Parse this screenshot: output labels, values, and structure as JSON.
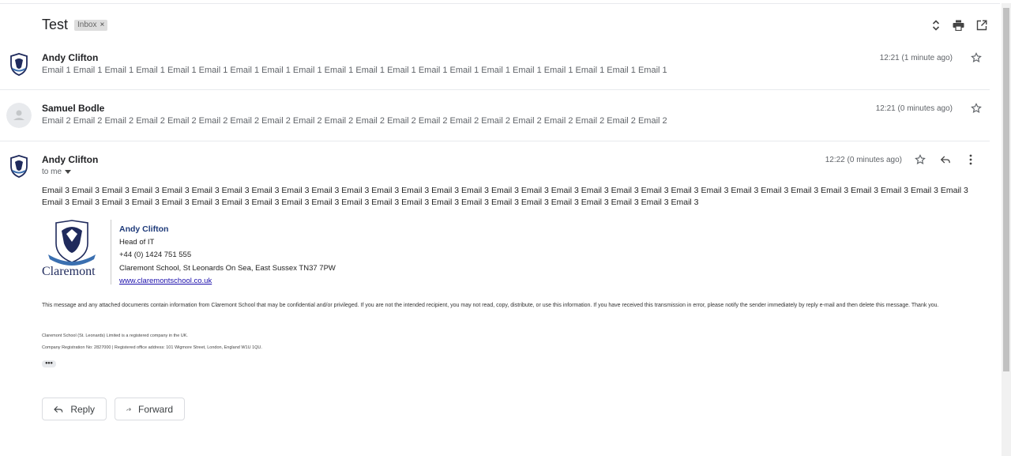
{
  "thread": {
    "subject": "Test",
    "label": "Inbox",
    "label_close": "×"
  },
  "toolbar": {
    "icons": [
      "expand-collapse-icon",
      "print-icon",
      "open-in-new-window-icon"
    ]
  },
  "messages": [
    {
      "sender": "Andy Clifton",
      "snippet": "Email 1 Email 1 Email 1 Email 1 Email 1 Email 1 Email 1 Email 1 Email 1 Email 1 Email 1 Email 1 Email 1 Email 1 Email 1 Email 1 Email 1 Email 1 Email 1 Email 1",
      "time": "12:21 (1 minute ago)"
    },
    {
      "sender": "Samuel Bodle",
      "snippet": "Email 2 Email 2 Email 2 Email 2 Email 2 Email 2 Email 2 Email 2 Email 2 Email 2 Email 2 Email 2 Email 2 Email 2 Email 2 Email 2 Email 2 Email 2 Email 2 Email 2",
      "time": "12:21 (0 minutes ago)"
    },
    {
      "sender": "Andy Clifton",
      "recipient": "to me",
      "time": "12:22 (0 minutes ago)",
      "body": "Email 3 Email 3 Email 3 Email 3 Email 3 Email 3 Email 3 Email 3 Email 3 Email 3 Email 3 Email 3 Email 3 Email 3 Email 3 Email 3 Email 3 Email 3 Email 3 Email 3 Email 3 Email 3 Email 3 Email 3 Email 3 Email 3 Email 3 Email 3 Email 3 Email 3 Email 3 Email 3 Email 3 Email 3 Email 3 Email 3 Email 3 Email 3 Email 3 Email 3 Email 3 Email 3 Email 3 Email 3 Email 3 Email 3 Email 3 Email 3 Email 3 Email 3 Email 3 Email 3 Email 3"
    }
  ],
  "signature": {
    "logo_word": "Claremont",
    "name": "Andy Clifton",
    "title": "Head of IT",
    "phone": "+44 (0) 1424 751 555",
    "address": "Claremont School, St Leonards On Sea, East Sussex TN37 7PW",
    "website": "www.claremontschool.co.uk",
    "accent_color": "#1f3b7a"
  },
  "disclaimer": "This message and any attached documents contain information from Claremont School that may be confidential and/or privileged. If you are not the intended recipient, you may not read, copy, distribute, or use this information. If you have received this transmission in error, please notify the sender immediately by reply e-mail and then delete this message. Thank you.",
  "company_line_1": "Claremont School (St. Leonards) Limited is a registered company in the UK.",
  "company_line_2": "Company Registration No: 2827000 | Registered office address: 101 Wigmore Street, London, England W1U 1QU.",
  "trimmed_content": "•••",
  "actions": {
    "reply": "Reply",
    "forward": "Forward"
  }
}
